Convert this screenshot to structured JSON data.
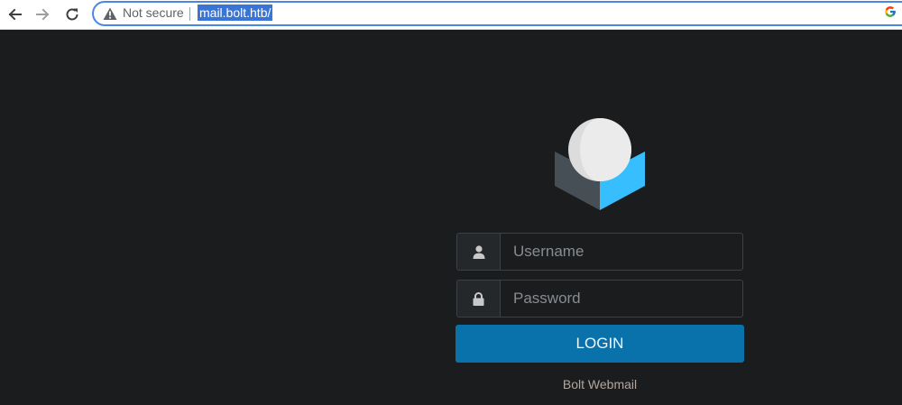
{
  "browser": {
    "security_label": "Not secure",
    "url": "mail.bolt.htb/",
    "icons": {
      "back": "arrow-left-icon",
      "forward": "arrow-right-icon",
      "reload": "reload-icon",
      "security": "warning-triangle-icon",
      "search_engine": "google-icon"
    }
  },
  "login": {
    "username_placeholder": "Username",
    "password_placeholder": "Password",
    "button_label": "LOGIN",
    "footer": "Bolt Webmail",
    "icons": {
      "logo": "roundcube-logo-icon",
      "username": "user-icon",
      "password": "lock-icon"
    }
  },
  "colors": {
    "page_background": "#1b1c1e",
    "button_primary": "#0a72aa",
    "logo_blue": "#37beff",
    "logo_dark": "#474f56",
    "logo_sphere": "#e3e3e3",
    "footer_text": "#b1a69d"
  }
}
